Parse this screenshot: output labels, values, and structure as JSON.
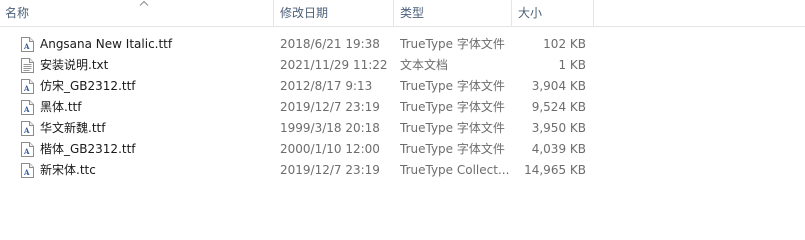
{
  "header": {
    "name": "名称",
    "date": "修改日期",
    "type": "类型",
    "size": "大小"
  },
  "files": [
    {
      "name": "Angsana New Italic.ttf",
      "date": "2018/6/21 19:38",
      "type": "TrueType 字体文件",
      "size": "102 KB",
      "icon": "font-file-icon"
    },
    {
      "name": "安装说明.txt",
      "date": "2021/11/29 11:22",
      "type": "文本文档",
      "size": "1 KB",
      "icon": "text-file-icon"
    },
    {
      "name": "仿宋_GB2312.ttf",
      "date": "2012/8/17 9:13",
      "type": "TrueType 字体文件",
      "size": "3,904 KB",
      "icon": "font-file-icon"
    },
    {
      "name": "黑体.ttf",
      "date": "2019/12/7 23:19",
      "type": "TrueType 字体文件",
      "size": "9,524 KB",
      "icon": "font-file-icon"
    },
    {
      "name": "华文新魏.ttf",
      "date": "1999/3/18 20:18",
      "type": "TrueType 字体文件",
      "size": "3,950 KB",
      "icon": "font-file-icon"
    },
    {
      "name": "楷体_GB2312.ttf",
      "date": "2000/1/10 12:00",
      "type": "TrueType 字体文件",
      "size": "4,039 KB",
      "icon": "font-file-icon"
    },
    {
      "name": "新宋体.ttc",
      "date": "2019/12/7 23:19",
      "type": "TrueType Collect...",
      "size": "14,965 KB",
      "icon": "font-file-icon"
    }
  ],
  "colors": {
    "header_text": "#4c607a",
    "secondary_text": "#6d6d6d",
    "font_icon_accent": "#2b5797"
  }
}
